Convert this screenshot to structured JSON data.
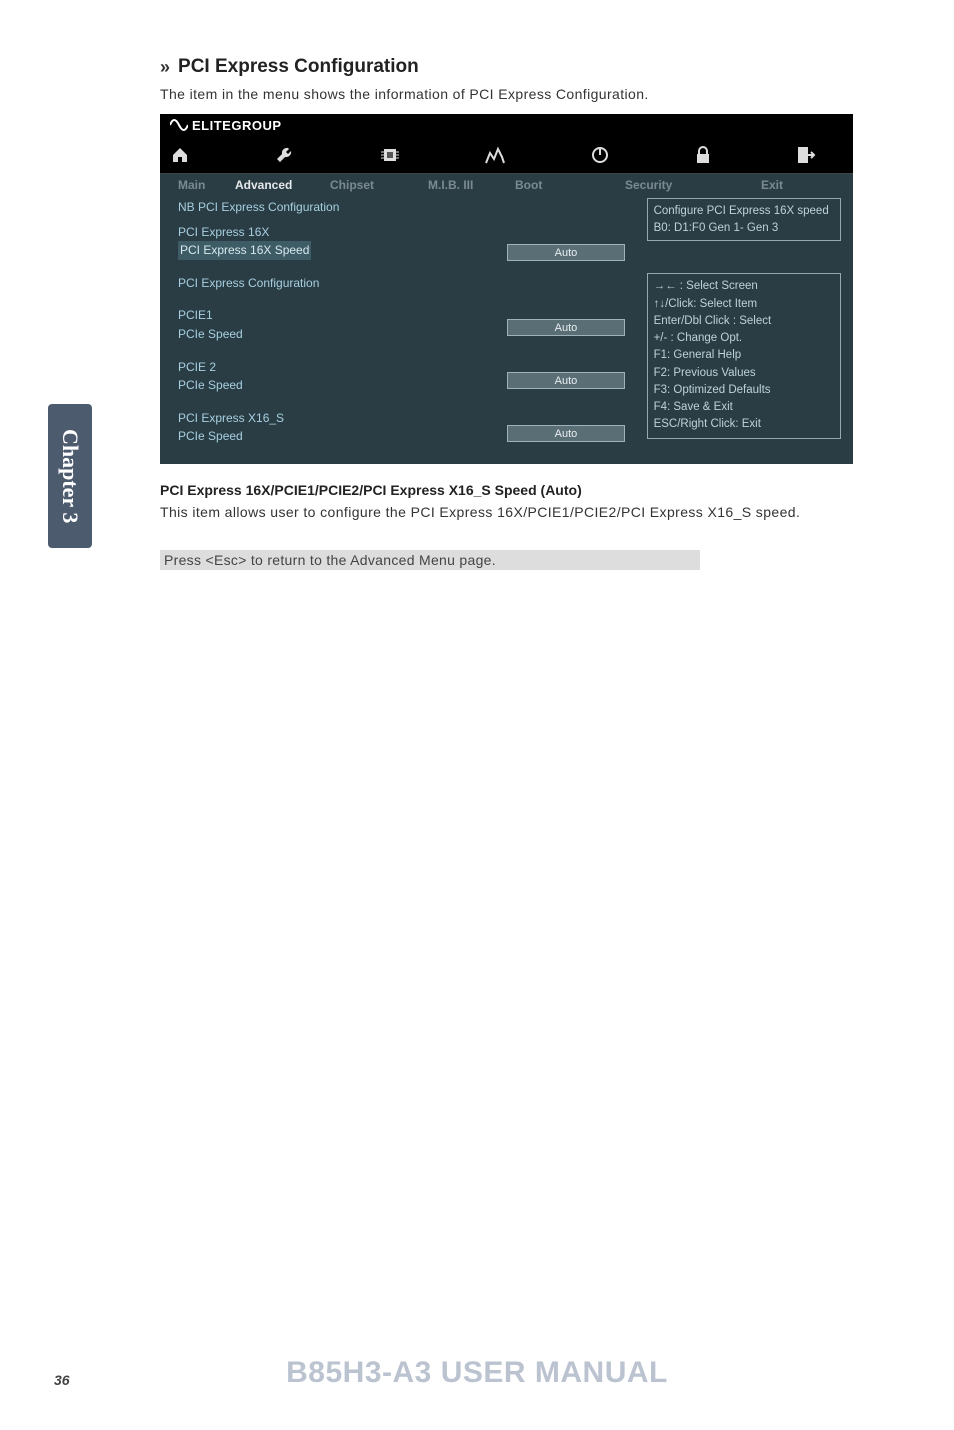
{
  "heading": "PCI Express Configuration",
  "intro": "The item in the menu shows the information of PCI Express Configuration.",
  "bios": {
    "brand_prefix": "ECS",
    "brand": "ELITEGROUP",
    "tabs": {
      "main": "Main",
      "advanced": "Advanced",
      "chipset": "Chipset",
      "mib": "M.I.B. III",
      "boot": "Boot",
      "security": "Security",
      "exit": "Exit"
    },
    "left": {
      "l1": "NB PCI Express Configuration",
      "l2": "PCI Express 16X",
      "l3": "PCI Express 16X Speed",
      "l4": "PCI Express Configuration",
      "l5": "PCIE1",
      "l6": "PCIe Speed",
      "l7": "PCIE 2",
      "l8": "PCIe Speed",
      "l9": "PCI Express X16_S",
      "l10": "PCIe Speed"
    },
    "opts": {
      "o1": "Auto",
      "o2": "Auto",
      "o3": "Auto",
      "o4": "Auto"
    },
    "help1": "Configure PCI Express 16X speed B0: D1:F0 Gen 1- Gen 3",
    "help2": {
      "h1": "→← : Select Screen",
      "h2": "↑↓/Click: Select Item",
      "h3": "Enter/Dbl Click : Select",
      "h4": "+/- : Change Opt.",
      "h5": "F1: General Help",
      "h6": "F2: Previous Values",
      "h7": "F3: Optimized Defaults",
      "h8": "F4: Save & Exit",
      "h9": "ESC/Right Click: Exit"
    }
  },
  "subhead": "PCI Express 16X/PCIE1/PCIE2/PCI Express X16_S Speed (Auto)",
  "subbody": "This item allows user to configure the PCI Express 16X/PCIE1/PCIE2/PCI Express X16_S speed.",
  "note": "Press <Esc> to return to the Advanced Menu page.",
  "side": "Chapter 3",
  "manual": "B85H3-A3 USER MANUAL",
  "page": "36"
}
